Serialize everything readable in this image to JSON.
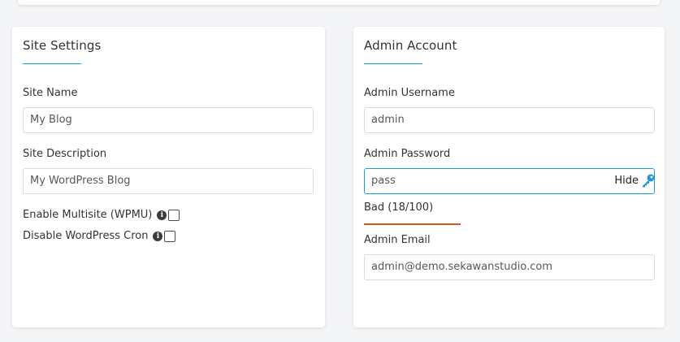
{
  "site_settings": {
    "title": "Site Settings",
    "site_name_label": "Site Name",
    "site_name_value": "My Blog",
    "site_description_label": "Site Description",
    "site_description_value": "My WordPress Blog",
    "multisite_label": "Enable Multisite (WPMU)",
    "cron_label": "Disable WordPress Cron",
    "multisite_checked": false,
    "cron_checked": false
  },
  "admin_account": {
    "title": "Admin Account",
    "username_label": "Admin Username",
    "username_value": "admin",
    "password_label": "Admin Password",
    "password_value": "pass",
    "hide_label": "Hide",
    "strength_text": "Bad (18/100)",
    "strength_fraction": 0.18,
    "email_label": "Admin Email",
    "email_value": "admin@demo.sekawanstudio.com"
  },
  "icons": {
    "info": "info-icon",
    "key": "key-icon"
  },
  "colors": {
    "accent": "#1e9bd7",
    "strength_bad": "#d4541c"
  }
}
